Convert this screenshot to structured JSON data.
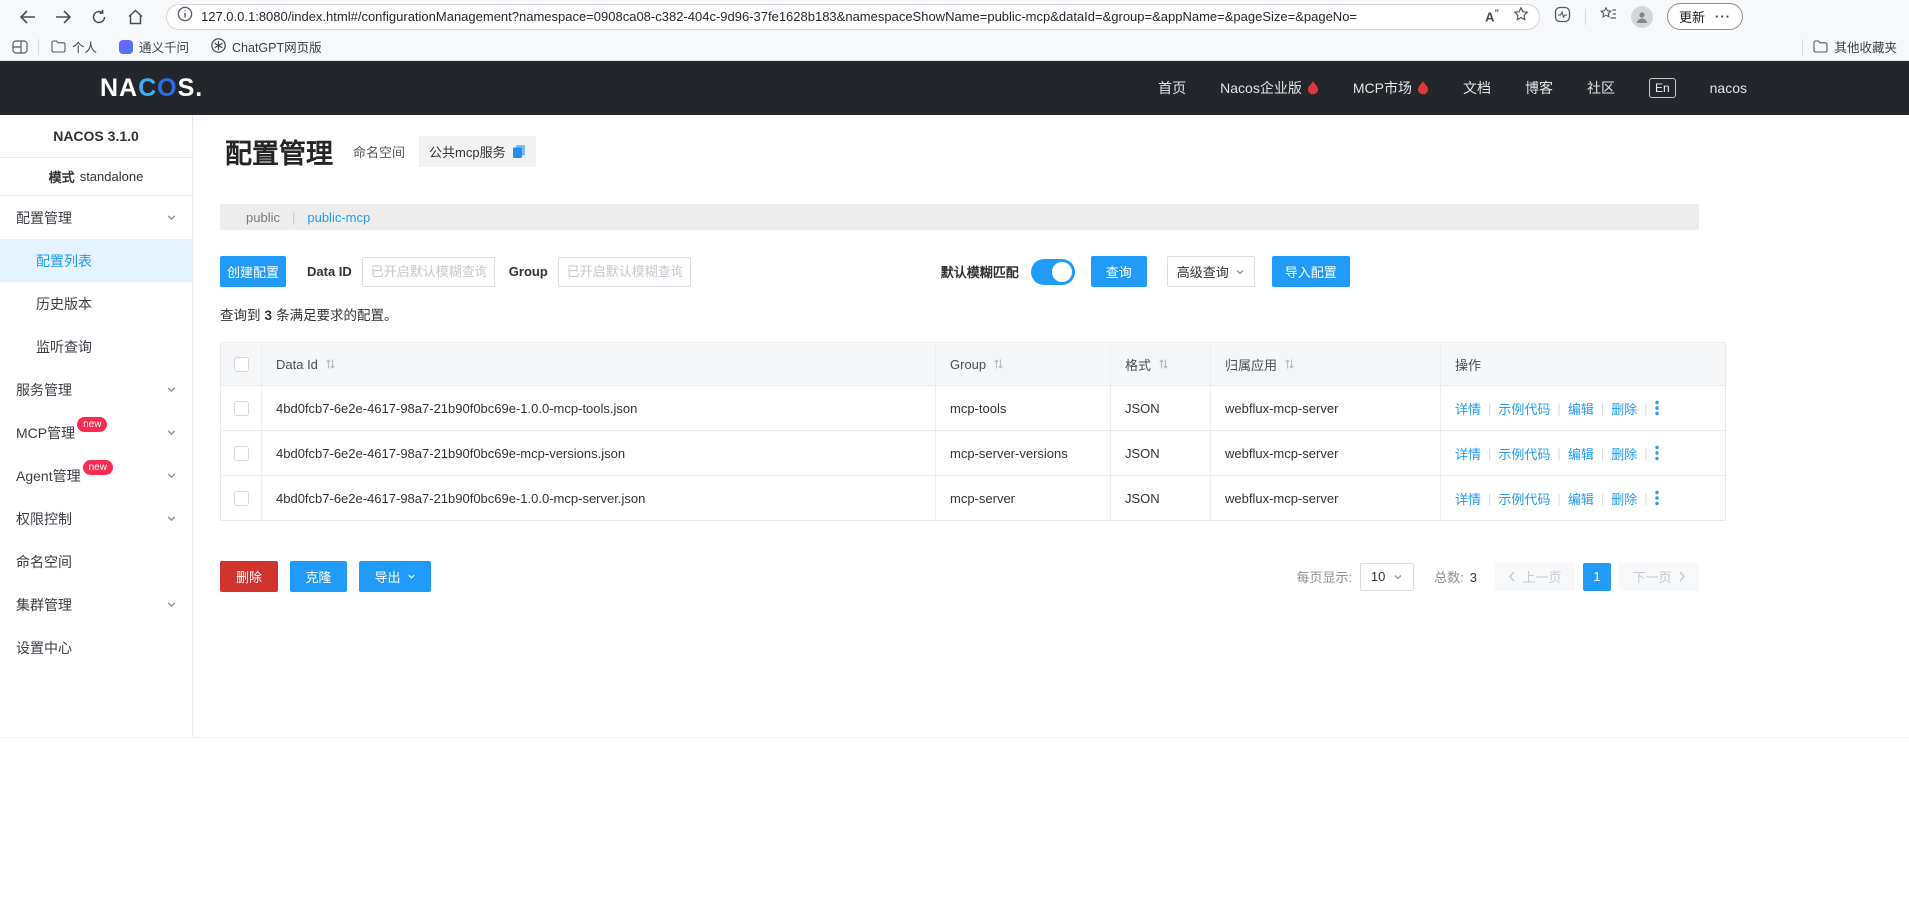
{
  "colors": {
    "accent": "#209bfa",
    "danger": "#d0342c",
    "badge": "#f72c50",
    "header_bg": "#23272c",
    "selected_bg": "#e4f3fe"
  },
  "browser": {
    "url": "127.0.0.1:8080/index.html#/configurationManagement?namespace=0908ca08-c382-404c-9d96-37fe1628b183&namespaceShowName=public-mcp&dataId=&group=&appName=&pageSize=&pageNo=",
    "update_label": "更新",
    "bookmarks": {
      "personal": "个人",
      "qianwen": "通义千问",
      "chatgpt": "ChatGPT网页版",
      "other": "其他收藏夹"
    }
  },
  "topnav": {
    "logo_na": "NA",
    "logo_c": "C",
    "logo_o": "O",
    "logo_s": "S.",
    "items": [
      {
        "label": "首页"
      },
      {
        "label": "Nacos企业版",
        "hot": true
      },
      {
        "label": "MCP市场",
        "hot": true
      },
      {
        "label": "文档"
      },
      {
        "label": "博客"
      },
      {
        "label": "社区"
      }
    ],
    "lang": "En",
    "user": "nacos"
  },
  "sidebar": {
    "version": "NACOS 3.1.0",
    "mode_label": "模式",
    "mode_value": "standalone",
    "groups": [
      {
        "label": "配置管理",
        "children": [
          "配置列表",
          "历史版本",
          "监听查询"
        ]
      },
      {
        "label": "服务管理"
      },
      {
        "label": "MCP管理",
        "badge": "new"
      },
      {
        "label": "Agent管理",
        "badge": "new"
      },
      {
        "label": "权限控制"
      },
      {
        "label": "命名空间"
      },
      {
        "label": "集群管理"
      },
      {
        "label": "设置中心"
      }
    ],
    "active_item": "配置列表"
  },
  "page": {
    "title": "配置管理",
    "namespace_label": "命名空间",
    "namespace_chip": "公共mcp服务",
    "tabs": {
      "left": "public",
      "right": "public-mcp"
    },
    "filter": {
      "create": "创建配置",
      "dataid_label": "Data ID",
      "dataid_placeholder": "已开启默认模糊查询",
      "group_label": "Group",
      "group_placeholder": "已开启默认模糊查询",
      "fuzzy_label": "默认模糊匹配",
      "fuzzy_on": true,
      "search": "查询",
      "advanced": "高级查询",
      "import": "导入配置"
    },
    "result": {
      "prefix": "查询到",
      "count": "3",
      "suffix": "条满足要求的配置。"
    },
    "table": {
      "headers": [
        "Data Id",
        "Group",
        "格式",
        "归属应用",
        "操作"
      ],
      "ops": [
        "详情",
        "示例代码",
        "编辑",
        "删除"
      ],
      "rows": [
        {
          "data_id": "4bd0fcb7-6e2e-4617-98a7-21b90f0bc69e-1.0.0-mcp-tools.json",
          "group": "mcp-tools",
          "format": "JSON",
          "app": "webflux-mcp-server"
        },
        {
          "data_id": "4bd0fcb7-6e2e-4617-98a7-21b90f0bc69e-mcp-versions.json",
          "group": "mcp-server-versions",
          "format": "JSON",
          "app": "webflux-mcp-server"
        },
        {
          "data_id": "4bd0fcb7-6e2e-4617-98a7-21b90f0bc69e-1.0.0-mcp-server.json",
          "group": "mcp-server",
          "format": "JSON",
          "app": "webflux-mcp-server"
        }
      ]
    },
    "footer": {
      "delete": "删除",
      "clone": "克隆",
      "export": "导出",
      "page_size_label": "每页显示:",
      "page_size": "10",
      "total_label": "总数:",
      "total": "3",
      "prev": "上一页",
      "page": "1",
      "next": "下一页"
    }
  }
}
